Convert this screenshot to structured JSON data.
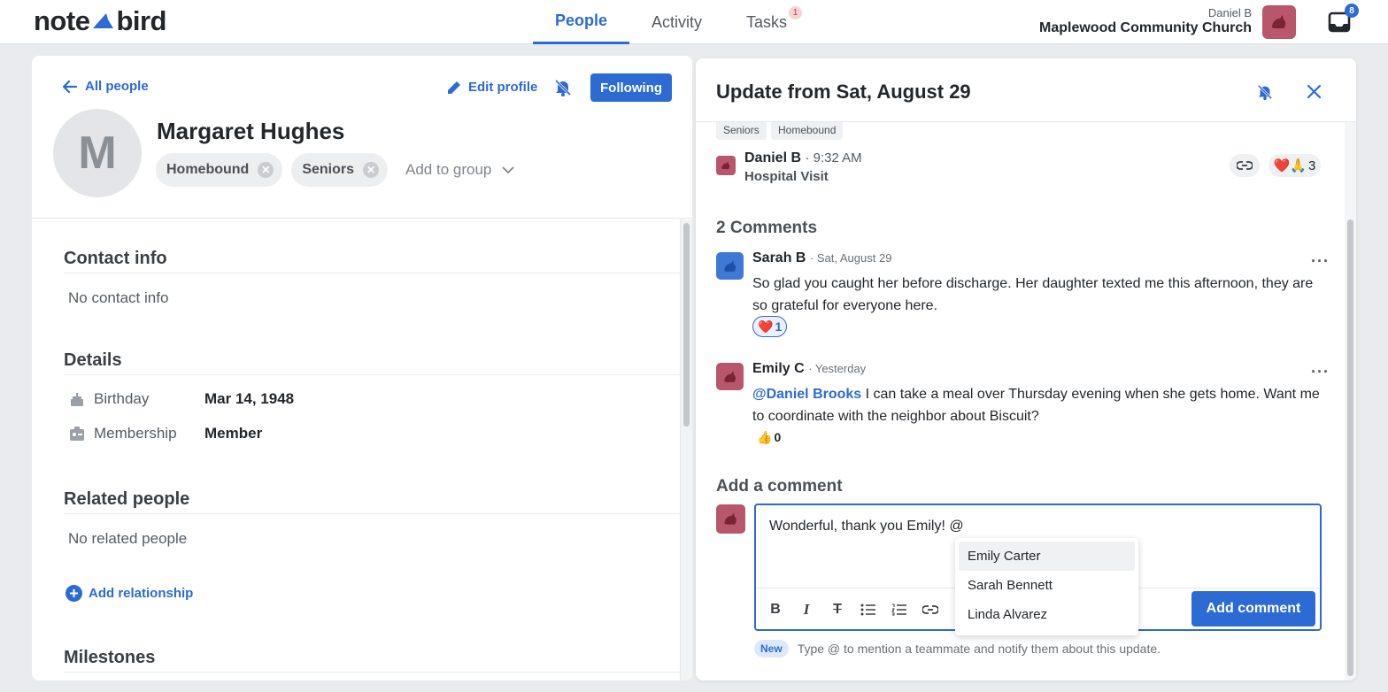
{
  "app": {
    "logo_left": "note",
    "logo_right": "bird",
    "nav_tabs": [
      {
        "label": "People",
        "active": true
      },
      {
        "label": "Activity",
        "active": false
      },
      {
        "label": "Tasks",
        "active": false,
        "badge": "1"
      }
    ],
    "user_name": "Daniel B",
    "org_name": "Maplewood Community Church",
    "inbox_count": "8"
  },
  "profile": {
    "back_label": "All people",
    "edit_label": "Edit profile",
    "follow_label": "Following",
    "avatar_initial": "M",
    "name": "Margaret Hughes",
    "groups": [
      "Homebound",
      "Seniors"
    ],
    "add_group_label": "Add to group"
  },
  "sections": {
    "contact_title": "Contact info",
    "contact_empty": "No contact info",
    "details_title": "Details",
    "details": [
      {
        "icon": "cake-icon",
        "label": "Birthday",
        "value": "Mar 14, 1948"
      },
      {
        "icon": "badge-icon",
        "label": "Membership",
        "value": "Member"
      }
    ],
    "related_title": "Related people",
    "related_empty": "No related people",
    "add_relationship_label": "Add relationship",
    "milestones_title": "Milestones"
  },
  "update": {
    "title": "Update from Sat, August 29",
    "tags": [
      "Seniors",
      "Homebound"
    ],
    "author": "Daniel B",
    "time": "· 9:32 AM",
    "subject": "Hospital Visit",
    "reaction_count": "3",
    "comments_title": "2 Comments",
    "comments": [
      {
        "author": "Sarah B",
        "when": "· Sat, August 29",
        "mention": "",
        "body": "So glad you caught her before discharge. Her daughter texted me this afternoon, they are so grateful for everyone here.",
        "reaction_emoji": "❤️",
        "reaction_count": "1"
      },
      {
        "author": "Emily C",
        "when": "· Yesterday",
        "mention": "@Daniel Brooks",
        "body": " I can take a meal over Thursday evening when she gets home. Want me to coordinate with the neighbor about Biscuit?",
        "reaction_emoji": "👍",
        "reaction_count": "0"
      }
    ],
    "add_comment_title": "Add a comment",
    "draft_text": "Wonderful, thank you Emily! @",
    "submit_label": "Add comment",
    "mention_options": [
      "Emily Carter",
      "Sarah Bennett",
      "Linda Alvarez"
    ],
    "hint_badge": "New",
    "hint_text": "Type @ to mention a teammate and notify them about this update."
  },
  "colors": {
    "accent": "#2c6bd3",
    "avatar_red": "#b8576b",
    "avatar_blue": "#3f78d6"
  }
}
